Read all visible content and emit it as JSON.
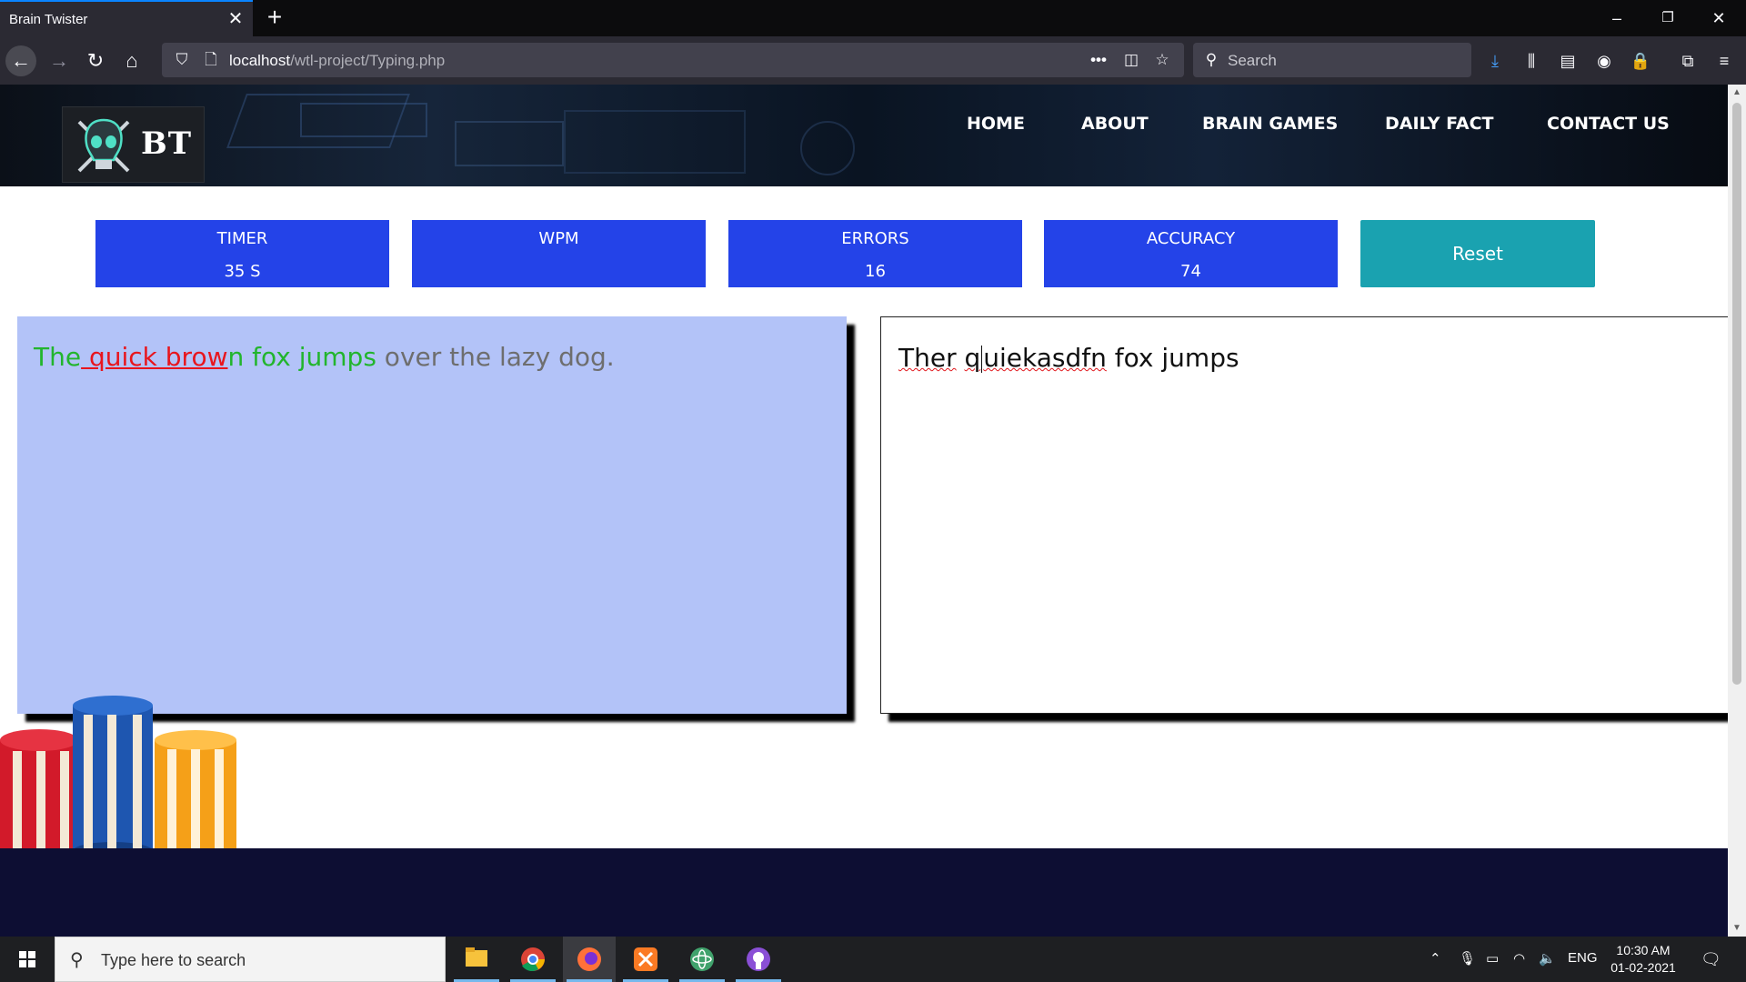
{
  "browser": {
    "tab_title": "Brain Twister",
    "url_host": "localhost",
    "url_path": "/wtl-project/Typing.php",
    "search_placeholder": "Search"
  },
  "site": {
    "logo_text": "BT",
    "nav": [
      "HOME",
      "ABOUT",
      "BRAIN GAMES",
      "DAILY FACT",
      "CONTACT US"
    ]
  },
  "stats": {
    "timer": {
      "label": "TIMER",
      "value": "35 S"
    },
    "wpm": {
      "label": "WPM",
      "value": ""
    },
    "errors": {
      "label": "ERRORS",
      "value": "16"
    },
    "accuracy": {
      "label": "ACCURACY",
      "value": "74"
    }
  },
  "reset_label": "Reset",
  "target_text": {
    "seg1": "The",
    "seg2": " quick brow",
    "seg3": "n fox jumps",
    "seg4": " over the lazy dog."
  },
  "typed_text": {
    "word1": "Ther",
    "word2a": "q",
    "word2b": "uiekasdfn",
    "rest": " fox jumps"
  },
  "taskbar": {
    "search_placeholder": "Type here to search",
    "lang": "ENG",
    "time": "10:30 AM",
    "date": "01-02-2021"
  },
  "colors": {
    "stat_bg": "#2443e8",
    "reset_bg": "#1aa2b0",
    "target_bg": "#b3c3f8",
    "correct": "#22b52d",
    "error": "#e8151d",
    "footer": "#0d0e33"
  }
}
